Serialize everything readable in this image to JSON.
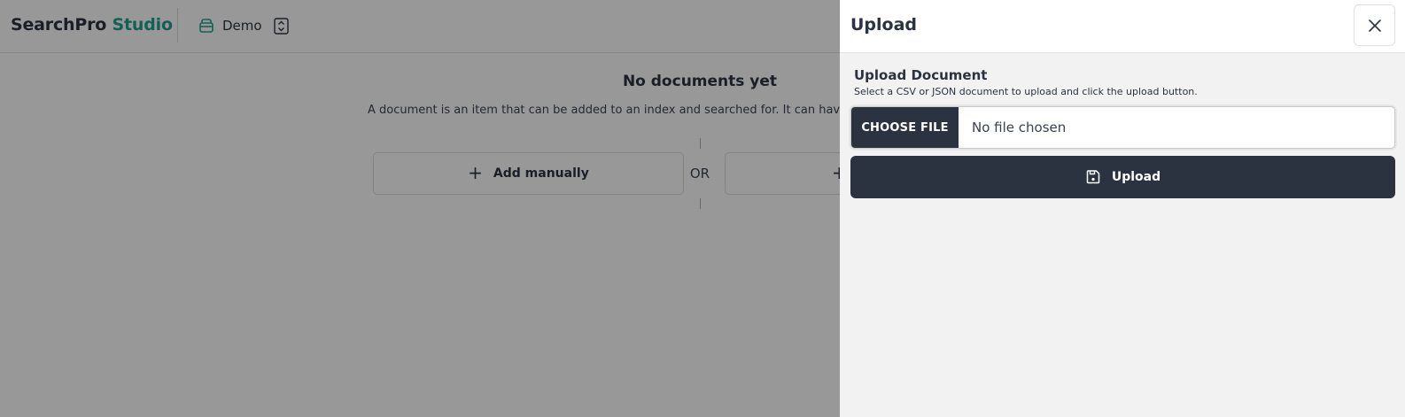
{
  "app": {
    "brand_main": "SearchPro",
    "brand_accent": "Studio",
    "project_name": "Demo"
  },
  "empty_state": {
    "title": "No documents yet",
    "description": "A document is an item that can be added to an index and searched for. It can have many fields.",
    "add_manually_label": "Add manually",
    "or_label": "OR",
    "second_action_plus": "+"
  },
  "drawer": {
    "title": "Upload",
    "section_title": "Upload Document",
    "section_description": "Select a CSV or JSON document to upload and click the upload button.",
    "choose_file_label": "CHOOSE FILE",
    "file_status": "No file chosen",
    "upload_label": "Upload"
  },
  "icons": {
    "project": "database-icon",
    "selector": "chevron-up-down-icon",
    "close": "close-icon",
    "add": "plus-icon",
    "upload": "save-icon"
  },
  "colors": {
    "accent": "#1f9c8c",
    "primary_dark": "#2b3240",
    "overlay": "rgba(0,0,0,0.38)"
  }
}
